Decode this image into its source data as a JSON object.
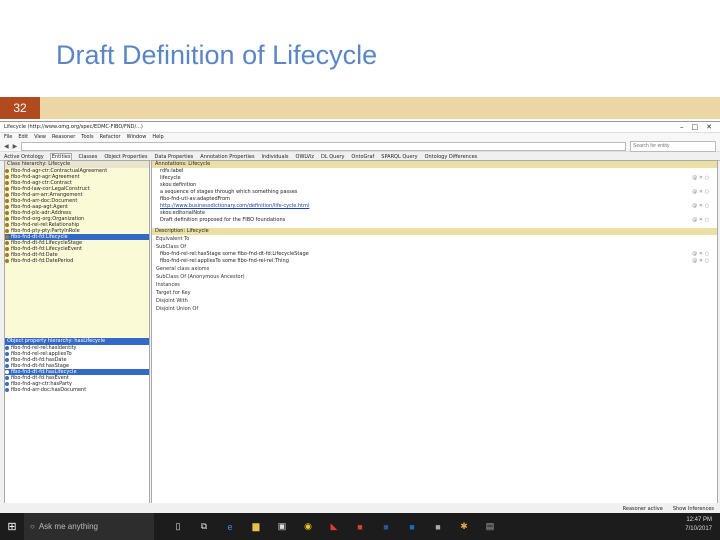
{
  "slide": {
    "title": "Draft Definition of Lifecycle",
    "number": "32"
  },
  "app": {
    "window_title": "Lifecycle (http://www.omg.org/spec/EDMC-FIBO/FND/...)",
    "menu": [
      "File",
      "Edit",
      "View",
      "Reasoner",
      "Tools",
      "Refactor",
      "Window",
      "Help"
    ],
    "search_placeholder": "Search for entity",
    "tabs": [
      "Active Ontology",
      "Entities",
      "Classes",
      "Object Properties",
      "Data Properties",
      "Annotation Properties",
      "Individuals",
      "OWLViz",
      "DL Query",
      "OntoGraf",
      "SPARQL Query",
      "Ontology Differences"
    ],
    "class_hierarchy_head": "Class hierarchy: Lifecycle",
    "class_tree": [
      "fibo-fnd-agr-ctr:ContractualAgreement",
      "fibo-fnd-agr-agr:Agreement",
      "fibo-fnd-agr-ctr:Contract",
      "fibo-fnd-law-cor:LegalConstruct",
      "fibo-fnd-arr-arr:Arrangement",
      "fibo-fnd-arr-doc:Document",
      "fibo-fnd-aap-agt:Agent",
      "fibo-fnd-plc-adr:Address",
      "fibo-fnd-org-org:Organization",
      "fibo-fnd-rel-rel:Relationship",
      "fibo-fnd-pty-pty:PartyInRole",
      "fibo-fnd-dt-fd:Lifecycle",
      "fibo-fnd-dt-fd:LifecycleStage",
      "fibo-fnd-dt-fd:LifecycleEvent",
      "fibo-fnd-dt-fd:Date",
      "fibo-fnd-dt-fd:DatePeriod"
    ],
    "lower_head": "Object property hierarchy: hasLifecycle",
    "property_tree": [
      "fibo-fnd-rel-rel:hasIdentity",
      "fibo-fnd-rel-rel:appliesTo",
      "fibo-fnd-dt-fd:hasDate",
      "fibo-fnd-dt-fd:hasStage",
      "fibo-fnd-dt-fd:hasLifecycle",
      "fibo-fnd-dt-fd:hasEvent",
      "fibo-fnd-agr-ctr:hasParty",
      "fibo-fnd-arr-doc:hasDocument"
    ],
    "annotations_head": "Annotations: Lifecycle",
    "annotations": [
      {
        "label": "rdfs:label",
        "value": "lifecycle"
      },
      {
        "label": "skos:definition",
        "value": "a sequence of stages through which something passes"
      },
      {
        "label": "fibo-fnd-utl-av:adaptedFrom",
        "value": "http://www.businessdictionary.com/definition/life-cycle.html"
      },
      {
        "label": "skos:editorialNote",
        "value": "Draft definition proposed for the FIBO foundations"
      }
    ],
    "description_head": "Description: Lifecycle",
    "description_sections": [
      "Equivalent To",
      "SubClass Of",
      "General class axioms",
      "SubClass Of (Anonymous Ancestor)",
      "Instances",
      "Target for Key",
      "Disjoint With",
      "Disjoint Union Of"
    ],
    "subclass_of": [
      "fibo-fnd-rel-rel:hasStage some fibo-fnd-dt-fd:LifecycleStage",
      "fibo-fnd-rel-rel:appliesTo some fibo-fnd-rel-rel:Thing"
    ],
    "status_items": [
      "Reasoner active",
      "Show Inferences"
    ]
  },
  "taskbar": {
    "search_text": "Ask me anything",
    "time": "12:47 PM",
    "date": "7/10/2017"
  }
}
